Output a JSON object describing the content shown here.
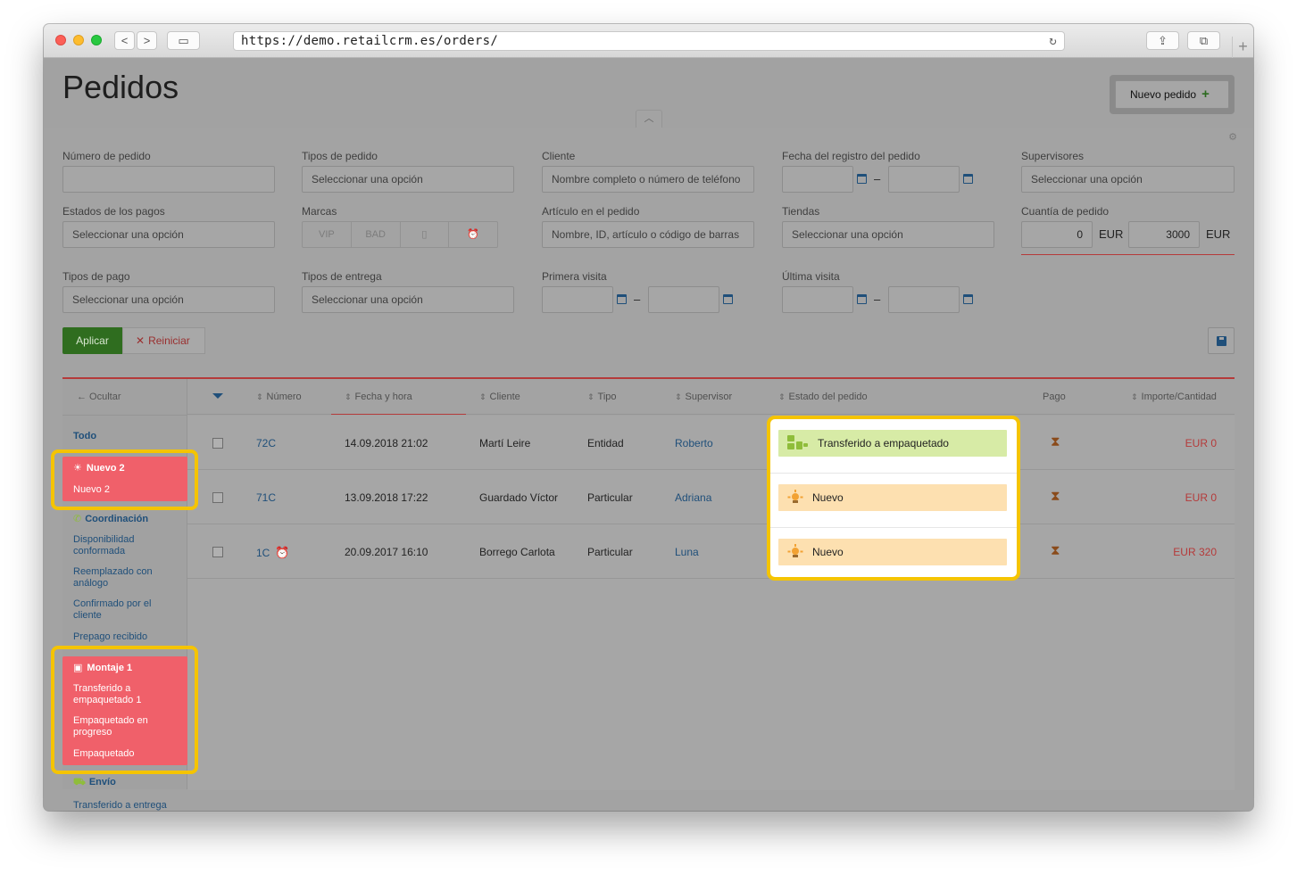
{
  "browser": {
    "url": "https://demo.retailcrm.es/orders/",
    "back_icon": "<",
    "forward_icon": ">",
    "sidebar_icon": "▭",
    "reload_icon": "↻",
    "share_icon": "⇪",
    "tabs_icon": "⧉",
    "newtab_icon": "+"
  },
  "header": {
    "title": "Pedidos",
    "new_order_label": "Nuevo pedido",
    "plus_icon": "+"
  },
  "filters": {
    "order_number": {
      "label": "Número de pedido",
      "placeholder": ""
    },
    "order_types": {
      "label": "Tipos de pedido",
      "placeholder": "Seleccionar una opción"
    },
    "client": {
      "label": "Cliente",
      "placeholder": "Nombre completo o número de teléfono"
    },
    "registration_date": {
      "label": "Fecha del registro del pedido",
      "separator": "–"
    },
    "supervisors": {
      "label": "Supervisores",
      "placeholder": "Seleccionar una opción"
    },
    "payment_states": {
      "label": "Estados de los pagos",
      "placeholder": "Seleccionar una opción"
    },
    "brands": {
      "label": "Marcas",
      "options": [
        "VIP",
        "BAD",
        "▯",
        "⏰"
      ]
    },
    "product": {
      "label": "Artículo en el pedido",
      "placeholder": "Nombre, ID, artículo o código de barras"
    },
    "stores": {
      "label": "Tiendas",
      "placeholder": "Seleccionar una opción"
    },
    "amount": {
      "label": "Cuantía de pedido",
      "from": "0",
      "to": "3000",
      "currency": "EUR"
    },
    "payment_types": {
      "label": "Tipos de pago",
      "placeholder": "Seleccionar una opción"
    },
    "delivery_types": {
      "label": "Tipos de entrega",
      "placeholder": "Seleccionar una opción"
    },
    "first_visit": {
      "label": "Primera visita",
      "separator": "–"
    },
    "last_visit": {
      "label": "Última visita",
      "separator": "–"
    },
    "apply_label": "Aplicar",
    "reset_label": "Reiniciar",
    "reset_icon": "✕",
    "gear_icon": "⚙"
  },
  "sidebar": {
    "hide_label": "← Ocultar",
    "all_label": "Todo",
    "nuevo_group": {
      "title": "Nuevo 2",
      "items": [
        "Nuevo 2"
      ]
    },
    "coordinacion_group": {
      "title": "Coordinación",
      "items": [
        "Disponibilidad conformada",
        "Reemplazado con análogo",
        "Confirmado por el cliente",
        "Prepago recibido"
      ]
    },
    "montaje_group": {
      "title": "Montaje 1",
      "items": [
        "Transferido a empaquetado 1",
        "Empaquetado en progreso",
        "Empaquetado"
      ]
    },
    "envio_group": {
      "title": "Envío",
      "items": [
        "Transferido a entrega"
      ]
    }
  },
  "table": {
    "columns": {
      "number": "Número",
      "date": "Fecha y hora",
      "client": "Cliente",
      "type": "Tipo",
      "supervisor": "Supervisor",
      "status": "Estado del pedido",
      "payment": "Pago",
      "amount": "Importe/Cantidad"
    },
    "sort_icon": "⇕",
    "rows": [
      {
        "number": "72C",
        "date": "14.09.2018 21:02",
        "client": "Martí Leire",
        "type": "Entidad",
        "supervisor": "Roberto",
        "status": "Transferido a empaquetado",
        "payment_icon": "⧗",
        "amount": "EUR 0"
      },
      {
        "number": "71C",
        "date": "13.09.2018 17:22",
        "client": "Guardado Víctor",
        "type": "Particular",
        "supervisor": "Adriana",
        "status": "Nuevo",
        "payment_icon": "⧗",
        "amount": "EUR 0"
      },
      {
        "number": "1C",
        "alarm_icon": "⏰",
        "date": "20.09.2017 16:10",
        "client": "Borrego Carlota",
        "type": "Particular",
        "supervisor": "Luna",
        "status": "Nuevo",
        "payment_icon": "⧗",
        "amount": "EUR 320"
      }
    ]
  },
  "colors": {
    "highlight_frame": "#f5c400",
    "highlight_fill": "#f0606a",
    "status_green": "#d7eba6",
    "status_orange": "#fde0b0",
    "apply_green": "#2f6d1f",
    "accent_red": "#b53a3a",
    "link_blue": "#1f4f7a"
  }
}
